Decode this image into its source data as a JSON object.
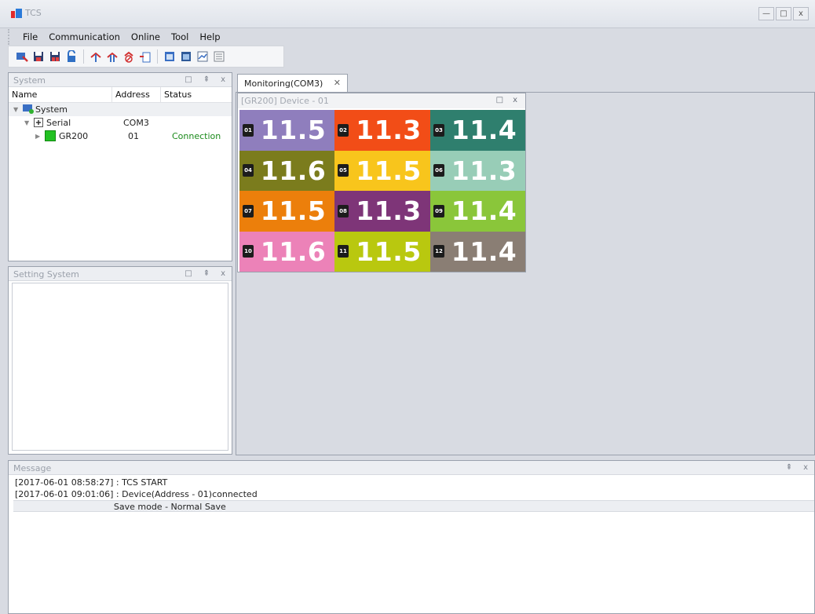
{
  "window": {
    "title": "TCS",
    "min": "—",
    "max": "□",
    "close": "x"
  },
  "menu": [
    "File",
    "Communication",
    "Online",
    "Tool",
    "Help"
  ],
  "toolbar": [
    "connect-icon",
    "save-icon",
    "save-as-icon",
    "unlock-icon",
    "add-device-icon",
    "add-device-alt-icon",
    "remove-device-icon",
    "device-settings-icon",
    "monitor-icon",
    "monitor-alt-icon",
    "chart-icon",
    "list-icon"
  ],
  "panels": {
    "system": {
      "title": "System",
      "columns": [
        "Name",
        "Address",
        "Status"
      ],
      "rows": [
        {
          "name": "System",
          "address": "",
          "status": ""
        },
        {
          "name": "Serial",
          "address": "COM3",
          "status": ""
        },
        {
          "name": "GR200",
          "address": "01",
          "status": "Connection"
        }
      ]
    },
    "setting": {
      "title": "Setting System"
    },
    "message": {
      "title": "Message",
      "lines": [
        "[2017-06-01 08:58:27] : TCS START",
        "[2017-06-01 09:01:06] : Device(Address - 01)connected",
        "                                    Save mode - Normal Save"
      ]
    }
  },
  "panel_controls": {
    "float": "□",
    "pin": "⇞",
    "close": "x"
  },
  "doc_tab": {
    "label": "Monitoring(COM3)",
    "close": "✕"
  },
  "device_window": {
    "title": "[GR200] Device - 01",
    "channels": [
      {
        "id": "01",
        "value": "11.5",
        "color": "#8f7ebd"
      },
      {
        "id": "02",
        "value": "11.3",
        "color": "#f24d17"
      },
      {
        "id": "03",
        "value": "11.4",
        "color": "#2f7f6e"
      },
      {
        "id": "04",
        "value": "11.6",
        "color": "#7b7c1d"
      },
      {
        "id": "05",
        "value": "11.5",
        "color": "#f8c51c"
      },
      {
        "id": "06",
        "value": "11.3",
        "color": "#98cdb7"
      },
      {
        "id": "07",
        "value": "11.5",
        "color": "#ec7f0b"
      },
      {
        "id": "08",
        "value": "11.3",
        "color": "#7e3578"
      },
      {
        "id": "09",
        "value": "11.4",
        "color": "#8ac63a"
      },
      {
        "id": "10",
        "value": "11.6",
        "color": "#ec82b8"
      },
      {
        "id": "11",
        "value": "11.5",
        "color": "#b9c80f"
      },
      {
        "id": "12",
        "value": "11.4",
        "color": "#8a7e74"
      }
    ]
  },
  "colors": {
    "status_connection": "#1a8a1a",
    "device_online": "#22c122"
  }
}
